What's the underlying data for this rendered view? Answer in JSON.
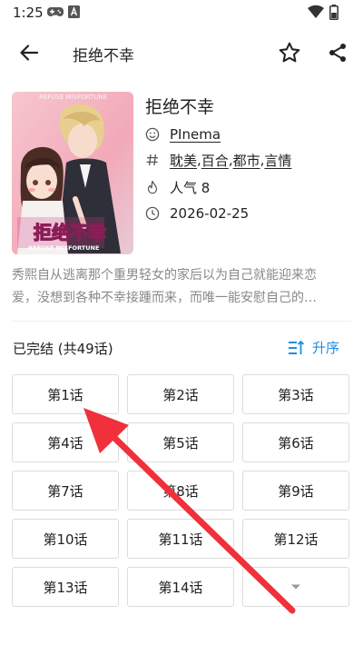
{
  "status_bar": {
    "time": "1:25"
  },
  "app_bar": {
    "title": "拒绝不幸"
  },
  "comic": {
    "title": "拒绝不幸",
    "author": "PInema",
    "tags": [
      "耽美",
      "百合",
      "都市",
      "言情"
    ],
    "popularity": "人气 8",
    "date": "2026-02-25",
    "cover": {
      "logo_text": "拒绝不幸",
      "logo_subtitle": "REFUSE MISFORTUNE",
      "top_text": "REFUSE MISFORTUNE"
    },
    "description_lines": [
      "秀熙自从逃离那个重男轻女的家后以为自己就能迎来恋",
      "爱，没想到各种不幸接踵而来，而唯一能安慰自己的…"
    ]
  },
  "chapters": {
    "status_label": "已完结 (共49话)",
    "sort_label": "升序",
    "items": [
      "第1话",
      "第2话",
      "第3话",
      "第4话",
      "第5话",
      "第6话",
      "第7话",
      "第8话",
      "第9话",
      "第10话",
      "第11话",
      "第12话",
      "第13话",
      "第14话"
    ]
  },
  "colors": {
    "accent": "#1a8fe0",
    "annotation_arrow": "#f0303a"
  },
  "icons": [
    "gamepad-icon",
    "a-badge-icon",
    "wifi-icon",
    "battery-icon",
    "back-arrow-icon",
    "star-outline-icon",
    "share-icon",
    "smiley-icon",
    "hash-icon",
    "flame-icon",
    "clock-icon",
    "sort-ascending-icon",
    "chevron-down-icon"
  ]
}
